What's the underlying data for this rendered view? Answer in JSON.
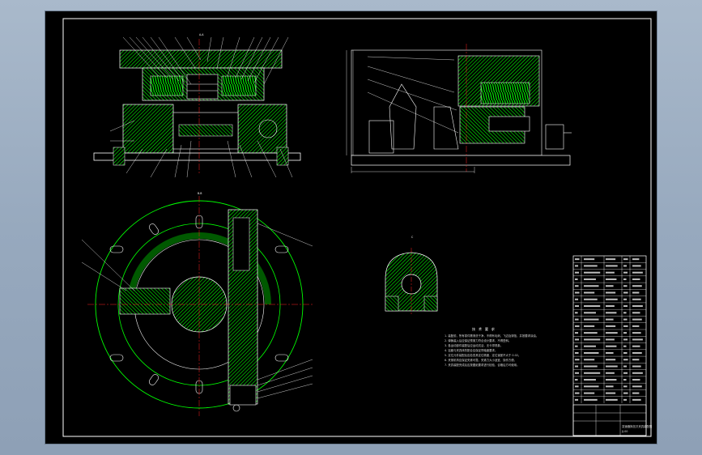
{
  "colors": {
    "background": "#000000",
    "outline": "#ffffff",
    "hatch": "#00ff00",
    "centerline": "#ff2020",
    "annotation": "#ffffff",
    "window": "#9fb0c4"
  },
  "drawing": {
    "tech_requirements_title": "技 术 要 求",
    "tech_requirements": [
      "1. 装配前，所有零件需清洗干净，不得有毛刺、飞边及锈蚀，并按要求涂油。",
      "2. 弹簧装入后应保证预紧力符合设计要求，不得歪斜。",
      "3. 各运动部件装配后应运动灵活，无卡滞现象。",
      "4. 钻套与夹具体的配合应保证同轴度要求。",
      "5. 定位元件装配后应检查其定位精度，定位误差不大于 0.02。",
      "6. 夹紧机构应保证夹紧可靠，夹紧力大小适宜，操作方便。",
      "7. 夹具装配完成后应按图纸要求进行检验，合格后方可使用。"
    ],
    "title_block": {
      "drawing_name": "变速器换挡叉夹具装配图",
      "drawing_no": "JJ-00"
    },
    "bom_rows": 22
  }
}
